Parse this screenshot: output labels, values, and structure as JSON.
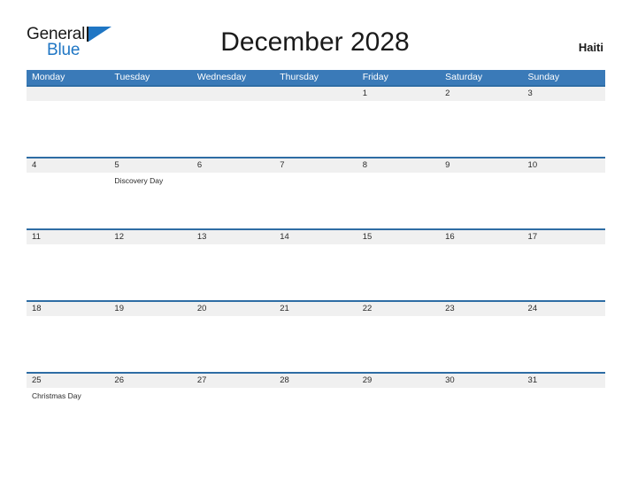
{
  "brand": {
    "name_primary": "General",
    "name_secondary": "Blue",
    "flag_icon": "flag-triangle-icon"
  },
  "header": {
    "title": "December 2028",
    "country": "Haiti"
  },
  "colors": {
    "header_blue": "#3a7ab8",
    "row_border_blue": "#2e6da4",
    "date_band_gray": "#f0f0f0",
    "logo_blue": "#1f76c4",
    "text_dark": "#1a1a1a",
    "page_background": "#ffffff"
  },
  "calendar": {
    "weekday_headers": [
      "Monday",
      "Tuesday",
      "Wednesday",
      "Thursday",
      "Friday",
      "Saturday",
      "Sunday"
    ],
    "weeks": [
      {
        "days": [
          {
            "date": "",
            "events": []
          },
          {
            "date": "",
            "events": []
          },
          {
            "date": "",
            "events": []
          },
          {
            "date": "",
            "events": []
          },
          {
            "date": "1",
            "events": []
          },
          {
            "date": "2",
            "events": []
          },
          {
            "date": "3",
            "events": []
          }
        ]
      },
      {
        "days": [
          {
            "date": "4",
            "events": []
          },
          {
            "date": "5",
            "events": [
              "Discovery Day"
            ]
          },
          {
            "date": "6",
            "events": []
          },
          {
            "date": "7",
            "events": []
          },
          {
            "date": "8",
            "events": []
          },
          {
            "date": "9",
            "events": []
          },
          {
            "date": "10",
            "events": []
          }
        ]
      },
      {
        "days": [
          {
            "date": "11",
            "events": []
          },
          {
            "date": "12",
            "events": []
          },
          {
            "date": "13",
            "events": []
          },
          {
            "date": "14",
            "events": []
          },
          {
            "date": "15",
            "events": []
          },
          {
            "date": "16",
            "events": []
          },
          {
            "date": "17",
            "events": []
          }
        ]
      },
      {
        "days": [
          {
            "date": "18",
            "events": []
          },
          {
            "date": "19",
            "events": []
          },
          {
            "date": "20",
            "events": []
          },
          {
            "date": "21",
            "events": []
          },
          {
            "date": "22",
            "events": []
          },
          {
            "date": "23",
            "events": []
          },
          {
            "date": "24",
            "events": []
          }
        ]
      },
      {
        "days": [
          {
            "date": "25",
            "events": [
              "Christmas Day"
            ]
          },
          {
            "date": "26",
            "events": []
          },
          {
            "date": "27",
            "events": []
          },
          {
            "date": "28",
            "events": []
          },
          {
            "date": "29",
            "events": []
          },
          {
            "date": "30",
            "events": []
          },
          {
            "date": "31",
            "events": []
          }
        ]
      }
    ]
  }
}
